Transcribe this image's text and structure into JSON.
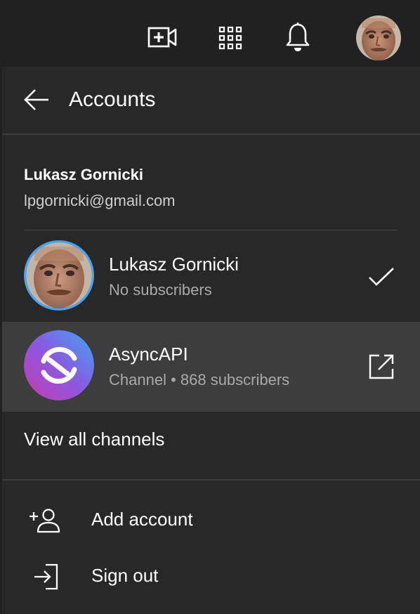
{
  "topbar": {
    "create_icon": "video-create-icon",
    "apps_icon": "apps-grid-icon",
    "notifications_icon": "bell-icon",
    "avatar_icon": "account-avatar"
  },
  "panel": {
    "title": "Accounts",
    "back_icon": "arrow-back-icon"
  },
  "account": {
    "name": "Lukasz Gornicki",
    "email": "lpgornicki@gmail.com"
  },
  "channels": [
    {
      "name": "Lukasz Gornicki",
      "subtitle": "No subscribers",
      "status_icon": "checkmark-icon",
      "selected": true
    },
    {
      "name": "AsyncAPI",
      "subtitle": "Channel • 868 subscribers",
      "status_icon": "open-external-icon",
      "selected": false
    }
  ],
  "view_all_label": "View all channels",
  "menu": {
    "add_account": "Add account",
    "sign_out": "Sign out"
  },
  "colors": {
    "background": "#282828",
    "topbar": "#212121",
    "hover_row": "#3d3d3d",
    "selected_ring": "#3ea6ff",
    "secondary_text": "#aaaaaa"
  }
}
